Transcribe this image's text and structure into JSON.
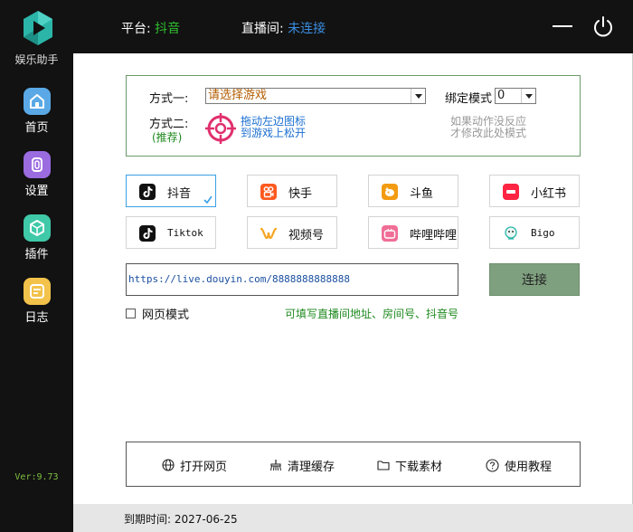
{
  "app": {
    "name": "娱乐助手",
    "version": "Ver:9.73"
  },
  "sidebar": {
    "items": [
      {
        "label": "首页",
        "icon": "home-icon",
        "color": "#5aa9e6"
      },
      {
        "label": "设置",
        "icon": "settings-icon",
        "color": "#9b6be0"
      },
      {
        "label": "插件",
        "icon": "plugin-icon",
        "color": "#3fc9a8"
      },
      {
        "label": "日志",
        "icon": "log-icon",
        "color": "#f2c24a"
      }
    ]
  },
  "header": {
    "platform_label": "平台:",
    "platform_value": "抖音",
    "room_label": "直播间:",
    "room_value": "未连接",
    "platform_color": "#2fbf2f",
    "room_color": "#3a8de0"
  },
  "mode": {
    "method1_label": "方式一:",
    "game_select": "请选择游戏",
    "bind_label": "绑定模式",
    "bind_value": "0",
    "method2_label": "方式二:",
    "recommend": "(推荐)",
    "drag_hint_line1": "拖动左边图标",
    "drag_hint_line2": "到游戏上松开",
    "fail_hint_line1": "如果动作没反应",
    "fail_hint_line2": "才修改此处模式"
  },
  "platforms": [
    {
      "label": "抖音",
      "icon": "douyin-icon",
      "selected": true
    },
    {
      "label": "快手",
      "icon": "kuaishou-icon",
      "selected": false
    },
    {
      "label": "斗鱼",
      "icon": "douyu-icon",
      "selected": false
    },
    {
      "label": "小红书",
      "icon": "xiaohongshu-icon",
      "selected": false
    },
    {
      "label": "Tiktok",
      "icon": "tiktok-icon",
      "selected": false
    },
    {
      "label": "视频号",
      "icon": "shipinhao-icon",
      "selected": false
    },
    {
      "label": "哔哩哔哩",
      "icon": "bilibili-icon",
      "selected": false
    },
    {
      "label": "Bigo",
      "icon": "bigo-icon",
      "selected": false
    }
  ],
  "connect": {
    "url": "https://live.douyin.com/8888888888888",
    "button": "连接",
    "web_mode": "网页模式",
    "hint": "可填写直播间地址、房间号、抖音号"
  },
  "toolbar": {
    "open_web": "打开网页",
    "clear_cache": "清理缓存",
    "download": "下载素材",
    "tutorial": "使用教程"
  },
  "footer": {
    "expire": "到期时间: 2027-06-25"
  }
}
